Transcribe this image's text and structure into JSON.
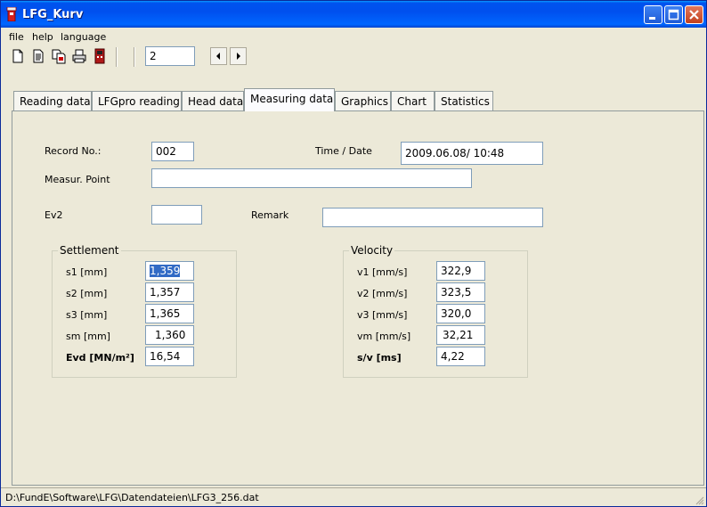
{
  "window": {
    "title": "LFG_Kurv"
  },
  "menu": [
    "file",
    "help",
    "language"
  ],
  "toolbar": {
    "icons": [
      "new-file-icon",
      "open-file-icon",
      "save-file-icon",
      "print-icon",
      "device-icon"
    ],
    "record_value": "2"
  },
  "tabs": [
    {
      "label": "Reading data",
      "active": false
    },
    {
      "label": "LFGpro reading",
      "active": false
    },
    {
      "label": "Head data",
      "active": false
    },
    {
      "label": "Measuring data",
      "active": true
    },
    {
      "label": "Graphics",
      "active": false
    },
    {
      "label": "Chart",
      "active": false
    },
    {
      "label": "Statistics",
      "active": false
    }
  ],
  "form": {
    "record_no_label": "Record No.:",
    "record_no": "002",
    "time_date_label": "Time / Date",
    "time_date": "2009.06.08/ 10:48",
    "measur_point_label": "Measur. Point",
    "measur_point": "",
    "ev2_label": "Ev2",
    "ev2": "",
    "remark_label": "Remark",
    "remark": ""
  },
  "settlement": {
    "title": "Settlement",
    "rows": [
      {
        "label": "s1 [mm]",
        "value": "1,359"
      },
      {
        "label": "s2 [mm]",
        "value": "1,357"
      },
      {
        "label": "s3 [mm]",
        "value": "1,365"
      },
      {
        "label": "sm [mm]",
        "value": "1,360"
      },
      {
        "label": "Evd [MN/m²]",
        "value": "16,54"
      }
    ]
  },
  "velocity": {
    "title": "Velocity",
    "rows": [
      {
        "label": "v1 [mm/s]",
        "value": "322,9"
      },
      {
        "label": "v2 [mm/s]",
        "value": "323,5"
      },
      {
        "label": "v3 [mm/s]",
        "value": "320,0"
      },
      {
        "label": "vm [mm/s]",
        "value": "32,21"
      },
      {
        "label": "s/v [ms]",
        "value": "4,22"
      }
    ]
  },
  "status": {
    "path": "D:\\FundE\\Software\\LFG\\Datendateien\\LFG3_256.dat"
  },
  "colors": {
    "titlebar": "#0054e3",
    "selection": "#316ac5",
    "face": "#ece9d8"
  }
}
